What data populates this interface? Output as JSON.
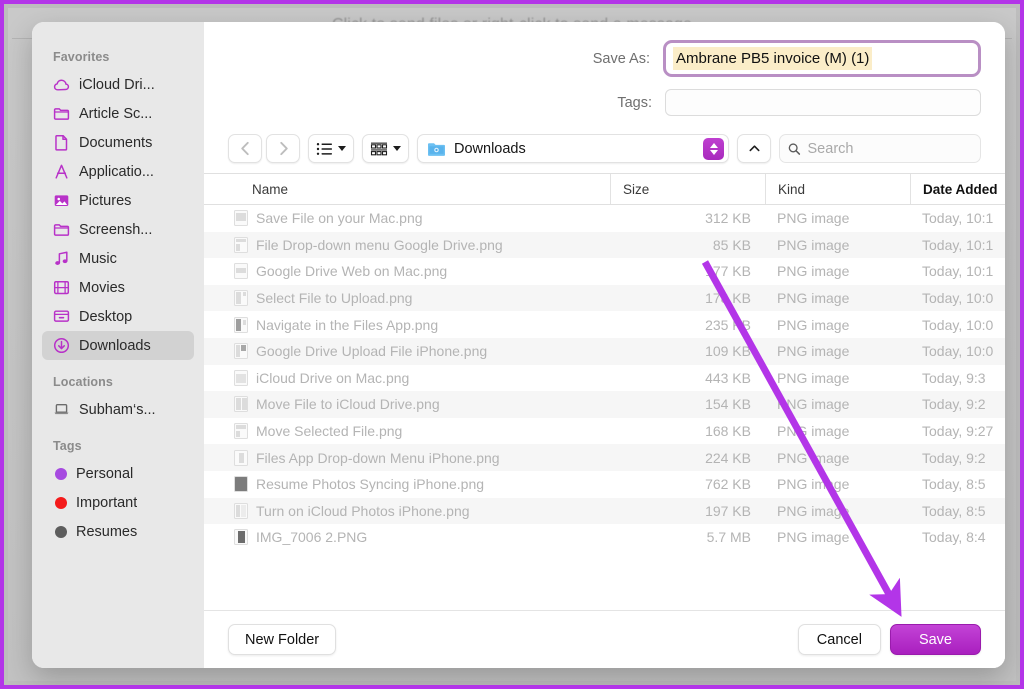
{
  "background": {
    "banner_text": "Click to send files or right-click to send a message"
  },
  "dialog": {
    "save_as_label": "Save As:",
    "save_as_value": "Ambrane PB5 invoice (M) (1)",
    "tags_label": "Tags:",
    "tags_value": "",
    "tags_placeholder": "",
    "path_label": "Downloads",
    "search_placeholder": "Search"
  },
  "sidebar": {
    "sections": [
      {
        "header": "Favorites",
        "items": [
          {
            "label": "iCloud Dri...",
            "icon": "icloud-icon",
            "selected": false
          },
          {
            "label": "Article Sc...",
            "icon": "folder-icon",
            "selected": false
          },
          {
            "label": "Documents",
            "icon": "document-icon",
            "selected": false
          },
          {
            "label": "Applicatio...",
            "icon": "applications-icon",
            "selected": false
          },
          {
            "label": "Pictures",
            "icon": "pictures-icon",
            "selected": false
          },
          {
            "label": "Screensh...",
            "icon": "folder-icon",
            "selected": false
          },
          {
            "label": "Music",
            "icon": "music-note-icon",
            "selected": false
          },
          {
            "label": "Movies",
            "icon": "film-icon",
            "selected": false
          },
          {
            "label": "Desktop",
            "icon": "desktop-icon",
            "selected": false
          },
          {
            "label": "Downloads",
            "icon": "downloads-icon",
            "selected": true
          }
        ]
      },
      {
        "header": "Locations",
        "items": [
          {
            "label": "Subham‘s...",
            "icon": "laptop-icon",
            "selected": false
          }
        ]
      },
      {
        "header": "Tags",
        "items": [
          {
            "label": "Personal",
            "icon": "tag-dot-icon",
            "color": "#a64ae0",
            "selected": false
          },
          {
            "label": "Important",
            "icon": "tag-dot-icon",
            "color": "#f41b1b",
            "selected": false
          },
          {
            "label": "Resumes",
            "icon": "tag-dot-icon",
            "color": "#5d5d5d",
            "selected": false
          }
        ]
      }
    ]
  },
  "file_list": {
    "columns": [
      {
        "label": "Name",
        "sorted": false
      },
      {
        "label": "Size",
        "sorted": false
      },
      {
        "label": "Kind",
        "sorted": false
      },
      {
        "label": "Date Added",
        "sorted": true
      }
    ],
    "rows": [
      {
        "name": "Save File on your Mac.png",
        "size": "312 KB",
        "kind": "PNG image",
        "date": "Today, 10:1"
      },
      {
        "name": "File Drop-down menu Google Drive.png",
        "size": "85 KB",
        "kind": "PNG image",
        "date": "Today, 10:1"
      },
      {
        "name": "Google Drive Web on Mac.png",
        "size": "177 KB",
        "kind": "PNG image",
        "date": "Today, 10:1"
      },
      {
        "name": "Select File to Upload.png",
        "size": "178 KB",
        "kind": "PNG image",
        "date": "Today, 10:0"
      },
      {
        "name": "Navigate in the Files App.png",
        "size": "235 KB",
        "kind": "PNG image",
        "date": "Today, 10:0"
      },
      {
        "name": "Google Drive Upload File iPhone.png",
        "size": "109 KB",
        "kind": "PNG image",
        "date": "Today, 10:0"
      },
      {
        "name": "iCloud Drive on Mac.png",
        "size": "443 KB",
        "kind": "PNG image",
        "date": "Today, 9:3"
      },
      {
        "name": "Move File to iCloud Drive.png",
        "size": "154 KB",
        "kind": "PNG image",
        "date": "Today, 9:2"
      },
      {
        "name": "Move Selected File.png",
        "size": "168 KB",
        "kind": "PNG image",
        "date": "Today, 9:27"
      },
      {
        "name": "Files App Drop-down Menu iPhone.png",
        "size": "224 KB",
        "kind": "PNG image",
        "date": "Today, 9:2"
      },
      {
        "name": "Resume Photos Syncing iPhone.png",
        "size": "762 KB",
        "kind": "PNG image",
        "date": "Today, 8:5"
      },
      {
        "name": "Turn on iCloud Photos iPhone.png",
        "size": "197 KB",
        "kind": "PNG image",
        "date": "Today, 8:5"
      },
      {
        "name": "IMG_7006 2.PNG",
        "size": "5.7 MB",
        "kind": "PNG image",
        "date": "Today, 8:4"
      }
    ]
  },
  "footer": {
    "new_folder_label": "New Folder",
    "cancel_label": "Cancel",
    "save_label": "Save"
  },
  "annotation": {
    "arrow_color": "#b335e8",
    "frame_color": "#b335e8"
  }
}
